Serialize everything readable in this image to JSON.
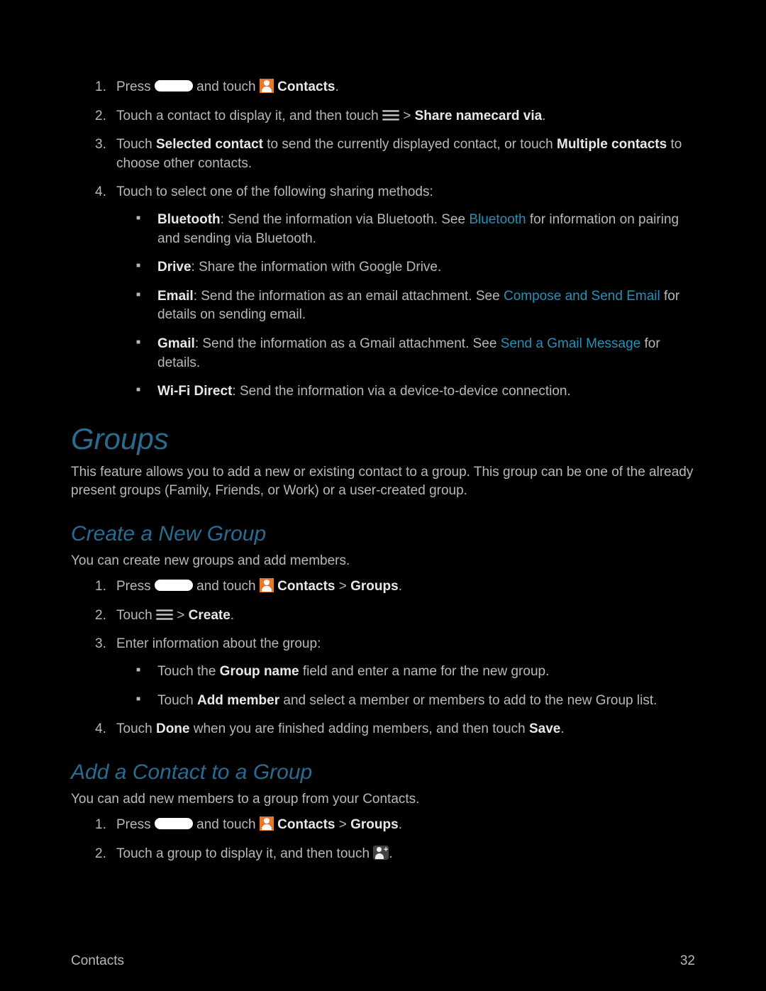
{
  "share": {
    "step1_press": "Press ",
    "step1_andtouch": " and touch ",
    "step1_contacts": " Contacts",
    "step2_a": "Touch a contact to display it, and then touch ",
    "step2_b": " > ",
    "step2_c": "Share namecard via",
    "step3_a": "Touch ",
    "step3_b": "Selected contact",
    "step3_c": " to send the currently displayed contact, or touch ",
    "step3_d": "Multiple contacts",
    "step3_e": " to choose other contacts.",
    "step4": "Touch to select one of the following sharing methods:",
    "bt_a": "Bluetooth",
    "bt_b": ": Send the information via Bluetooth. See ",
    "bt_link": "Bluetooth",
    "bt_c": " for information on pairing and sending via Bluetooth.",
    "drive_a": "Drive",
    "drive_b": ": Share the information with Google Drive.",
    "email_a": "Email",
    "email_b": ": Send the information as an email attachment. See ",
    "email_link": "Compose and Send Email",
    "email_c": " for details on sending email.",
    "gmail_a": "Gmail",
    "gmail_b": ": Send the information as a Gmail attachment. See ",
    "gmail_link": "Send a Gmail Message",
    "gmail_c": " for details.",
    "wifi_a": "Wi-Fi Direct",
    "wifi_b": ": Send the information via a device-to-device connection."
  },
  "groups": {
    "heading": "Groups",
    "intro": "This feature allows you to add a new or existing contact to a group. This group can be one of the already present groups (Family, Friends, or Work) or a user-created group."
  },
  "create": {
    "heading": "Create a New Group",
    "intro": "You can create new groups and add members.",
    "s1a": "Press ",
    "s1b": " and touch ",
    "s1c": " Contacts",
    "s1d": " > ",
    "s1e": "Groups",
    "s2a": "Touch ",
    "s2b": " > ",
    "s2c": "Create",
    "s3": "Enter information about the group:",
    "b1a": "Touch the ",
    "b1b": "Group name",
    "b1c": " field and enter a name for the new group.",
    "b2a": "Touch ",
    "b2b": "Add member",
    "b2c": " and select a member or members to add to the new Group list.",
    "s4a": "Touch ",
    "s4b": "Done",
    "s4c": " when you are finished adding members, and then touch ",
    "s4d": "Save"
  },
  "add": {
    "heading": "Add a Contact to a Group",
    "intro": "You can add new members to a group from your Contacts.",
    "s1a": "Press ",
    "s1b": " and touch ",
    "s1c": " Contacts",
    "s1d": " > ",
    "s1e": "Groups",
    "s2": "Touch a group to display it, and then touch "
  },
  "footer": {
    "left": "Contacts",
    "right": "32"
  }
}
